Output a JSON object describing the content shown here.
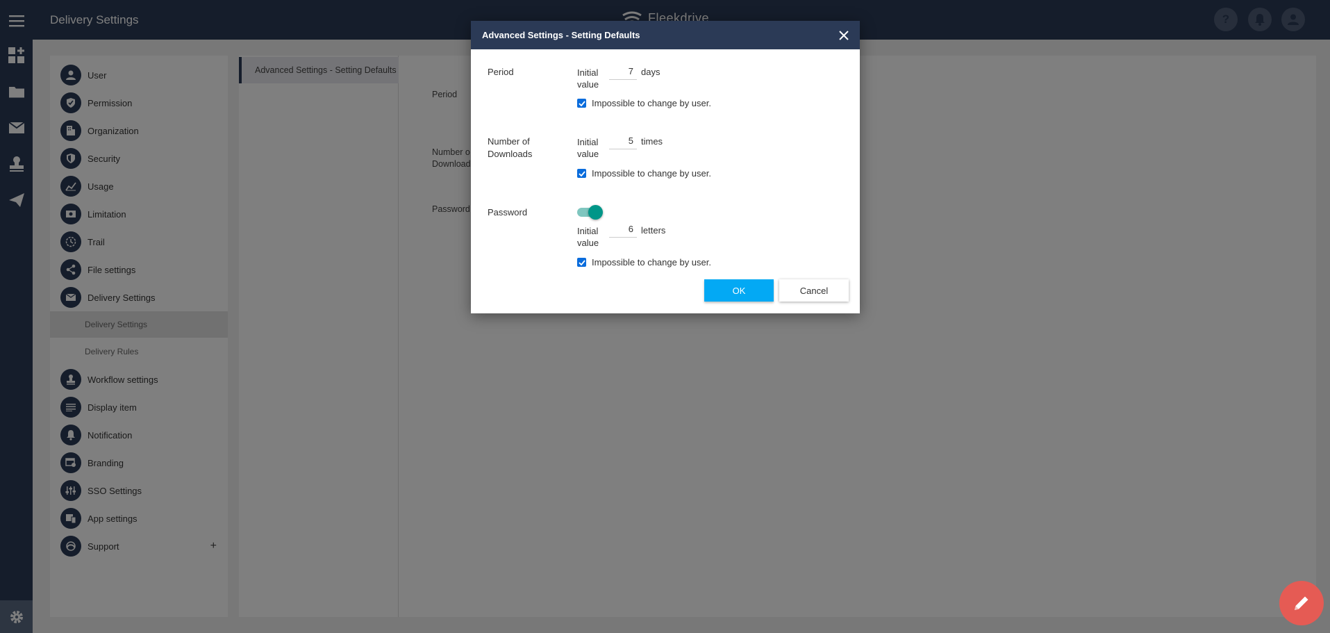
{
  "header": {
    "title": "Delivery Settings",
    "brand": "Fleekdrive",
    "help_icon": "question-icon",
    "notification_icon": "bell-icon",
    "profile_icon": "user-avatar-icon"
  },
  "rail": {
    "items": [
      "menu-icon",
      "dashboard-add-icon",
      "folder-icon",
      "mail-icon",
      "stamp-icon",
      "send-icon"
    ],
    "settings_icon": "gear-icon"
  },
  "nav": {
    "items": [
      {
        "label": "User",
        "icon": "user-icon"
      },
      {
        "label": "Permission",
        "icon": "shield-check-icon"
      },
      {
        "label": "Organization",
        "icon": "building-icon"
      },
      {
        "label": "Security",
        "icon": "shield-icon"
      },
      {
        "label": "Usage",
        "icon": "chart-icon"
      },
      {
        "label": "Limitation",
        "icon": "limit-icon"
      },
      {
        "label": "Trail",
        "icon": "clock-icon"
      },
      {
        "label": "File settings",
        "icon": "share-icon"
      },
      {
        "label": "Delivery Settings",
        "icon": "mail-icon"
      },
      {
        "label": "Workflow settings",
        "icon": "stamp-icon"
      },
      {
        "label": "Display item",
        "icon": "list-icon"
      },
      {
        "label": "Notification",
        "icon": "bell-icon"
      },
      {
        "label": "Branding",
        "icon": "branding-icon"
      },
      {
        "label": "SSO Settings",
        "icon": "sliders-icon"
      },
      {
        "label": "App settings",
        "icon": "devices-icon"
      },
      {
        "label": "Support",
        "icon": "support-icon"
      }
    ],
    "sub_items": [
      {
        "label": "Delivery Settings",
        "active": true
      },
      {
        "label": "Delivery Rules",
        "active": false
      }
    ],
    "support_expand": "+"
  },
  "content": {
    "tab_label": "Advanced Settings - Setting Defaults",
    "labels": {
      "period": "Period",
      "downloads_line1": "Number o",
      "downloads_line2": "Download",
      "password": "Password"
    }
  },
  "dialog": {
    "title": "Advanced Settings - Setting Defaults",
    "close_icon": "close-icon",
    "period": {
      "label": "Period",
      "initial_line1": "Initial",
      "initial_line2": "value",
      "value": "7",
      "unit": "days",
      "lock_label": "Impossible to change by user.",
      "locked": true
    },
    "downloads": {
      "label_line1": "Number of",
      "label_line2": "Downloads",
      "initial_line1": "Initial",
      "initial_line2": "value",
      "value": "5",
      "unit": "times",
      "lock_label": "Impossible to change by user.",
      "locked": true
    },
    "password": {
      "label": "Password",
      "enabled": true,
      "initial_line1": "Initial",
      "initial_line2": "value",
      "value": "6",
      "unit": "letters",
      "lock_label": "Impossible to change by user.",
      "locked": true
    },
    "ok_label": "OK",
    "cancel_label": "Cancel"
  },
  "fab_icon": "pencil-icon",
  "colors": {
    "navy": "#2b3a56",
    "primary_button": "#03a9f4",
    "toggle_on": "#009688",
    "fab": "#e55b54",
    "checkbox": "#0a6cdc"
  }
}
